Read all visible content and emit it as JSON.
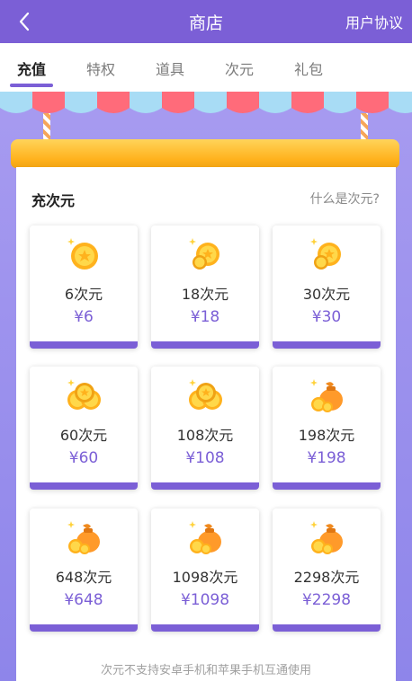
{
  "header": {
    "title": "商店",
    "agreement": "用户协议"
  },
  "tabs": [
    {
      "label": "充值",
      "active": true
    },
    {
      "label": "特权",
      "active": false
    },
    {
      "label": "道具",
      "active": false
    },
    {
      "label": "次元",
      "active": false
    },
    {
      "label": "礼包",
      "active": false
    }
  ],
  "section": {
    "title": "充次元",
    "help": "什么是次元?"
  },
  "packages": [
    {
      "amount": "6次元",
      "price": "¥6",
      "icon": "coin-icon"
    },
    {
      "amount": "18次元",
      "price": "¥18",
      "icon": "coins-icon"
    },
    {
      "amount": "30次元",
      "price": "¥30",
      "icon": "coins-icon"
    },
    {
      "amount": "60次元",
      "price": "¥60",
      "icon": "coin-pile-icon"
    },
    {
      "amount": "108次元",
      "price": "¥108",
      "icon": "coin-pile-icon"
    },
    {
      "amount": "198次元",
      "price": "¥198",
      "icon": "money-bag-icon"
    },
    {
      "amount": "648次元",
      "price": "¥648",
      "icon": "money-bag-icon"
    },
    {
      "amount": "1098次元",
      "price": "¥1098",
      "icon": "money-bag-icon"
    },
    {
      "amount": "2298次元",
      "price": "¥2298",
      "icon": "money-bag-icon"
    }
  ],
  "footer_note": "次元不支持安卓手机和苹果手机互通使用",
  "colors": {
    "brand": "#7b5fd6",
    "gold": "#ffb21d"
  }
}
